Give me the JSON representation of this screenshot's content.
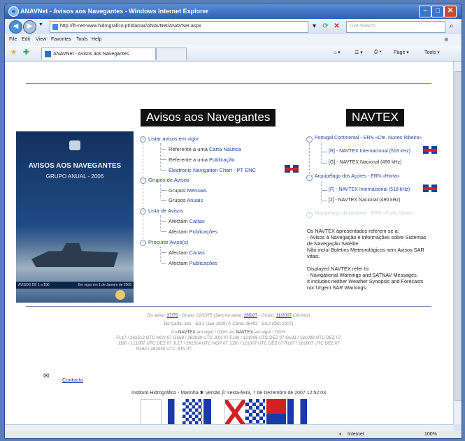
{
  "window": {
    "title": "ANAVNet - Avisos aos Navegantes - Windows Internet Explorer"
  },
  "addressbar": {
    "url": "http://lh-net-www.hidrografico.pt/Idamar/ANAVNet/ANAVNet.aspx",
    "search_placeholder": "Live Search"
  },
  "menubar": {
    "items": [
      "File",
      "Edit",
      "View",
      "Favorites",
      "Tools",
      "Help"
    ]
  },
  "favbar": {
    "tab_title": "ANAVNet - Avisos aos Navegantes",
    "page_label": "Page",
    "tools_label": "Tools"
  },
  "page": {
    "title_left": "Avisos aos Navegantes",
    "title_right": "NAVTEX",
    "cover": {
      "title": "AVISOS AOS NAVEGANTES",
      "subtitle": "GRUPO ANUAL - 2006",
      "strip_left": "AVISOS DE 1 a 100",
      "strip_right": "Em vigor em 1 de Janeiro de 2006"
    },
    "tree": {
      "listar": "Listar avisos em vigor",
      "ref_carta_prefix": "Referente a uma",
      "ref_carta_link": "Carta Náutica",
      "ref_pub_prefix": "Referente a uma",
      "ref_pub_link": "Publicação",
      "enc": "Electronic Navigation Chart - PT ENC",
      "grupos": "Grupos de Avisos",
      "grupos_prefix": "Grupos",
      "grupos_mensais": "Mensais",
      "grupos_anuais": "Anuais",
      "lista": "Lista de Avisos",
      "afectam_prefix": "Afectam",
      "afectam_cartas": "Cartas",
      "afectam_pub": "Publicações",
      "procurar": "Procurar Aviso(s)"
    },
    "navtex": {
      "pt_continental": "Portugal Continental - ERN «Cte. Nunes Ribeiro»",
      "r_int": "[R] - NAVTEX Internacional (518 kHz)",
      "g_nac": "[G] - NAVTEX Nacional (490 kHz)",
      "acores": "Arquipélago dos Açores - ERN «Horta»",
      "f_int": "[F] - NAVTEX Internacional (518 kHz)",
      "j_nac": "[J] - NAVTEX Nacional (490 kHz)",
      "madeira": "Arquipélago da Madeira - ERN «Porto Santo»",
      "note_pt": [
        "Os NAVTEX apresentados referem-se a:",
        "- Avisos à Navegação e informações sobre Sistemas",
        "de Navegação Satélite.",
        "Não inclui Boletins Meteorológicos nem Avisos SAR",
        "vitais."
      ],
      "note_en": [
        "Displayed NAVTEX refer to:",
        "- Navigational Warnings and SATNAV Messages.",
        "It includes neither Weather Synopsis and Forecasts",
        "nor Urgent SAR Warnings."
      ]
    },
    "footer_info": {
      "line1_a": "Do aviso: ",
      "line1_a_link": "37/75",
      "line1_b": " - Grupo: 02/1975 (Jan)   Ao aviso: ",
      "line1_b_link": "265/07",
      "line1_c": " - Grupo: ",
      "line1_c_link": "11/2007",
      "line1_d": " (30-Nov)",
      "line2": "De Carta: 161 - Ed.1 (Jan-1939)   À Carta: 36402 - Ed.2 (Out-2007)",
      "line3_a": "Do ",
      "line3_b": "NAVTEX",
      "line3_c": " em vigor / GDH:   Ao ",
      "line3_d": "NAVTEX",
      "line3_e": " em vigor / GDH:",
      "line4": "FL17 / 261512 UTC NOV 07 GL69 / 282030 UTC JUN 07   FJ30 / 121006 UTC DEZ 07 GL93 / 181008 UTC DEZ 07",
      "line5": "JJ30 / 121007 UTC DEZ 07 JL17 / 261514 UTC NOV 07   JJ30 / 121007 UTC DEZ 07 RL87 / 181007 UTC DEZ 07",
      "line6": "RL62 / 282030 UTC JUN 07"
    },
    "contact_label": "Contacto",
    "footer_line": "Instituto Hidrográfico - Marinha ✱ Versão β: sexta-feira, 7 de Dezembro de 2007 12:52:03"
  },
  "statusbar": {
    "zone": "Internet",
    "zoom": "100%"
  }
}
